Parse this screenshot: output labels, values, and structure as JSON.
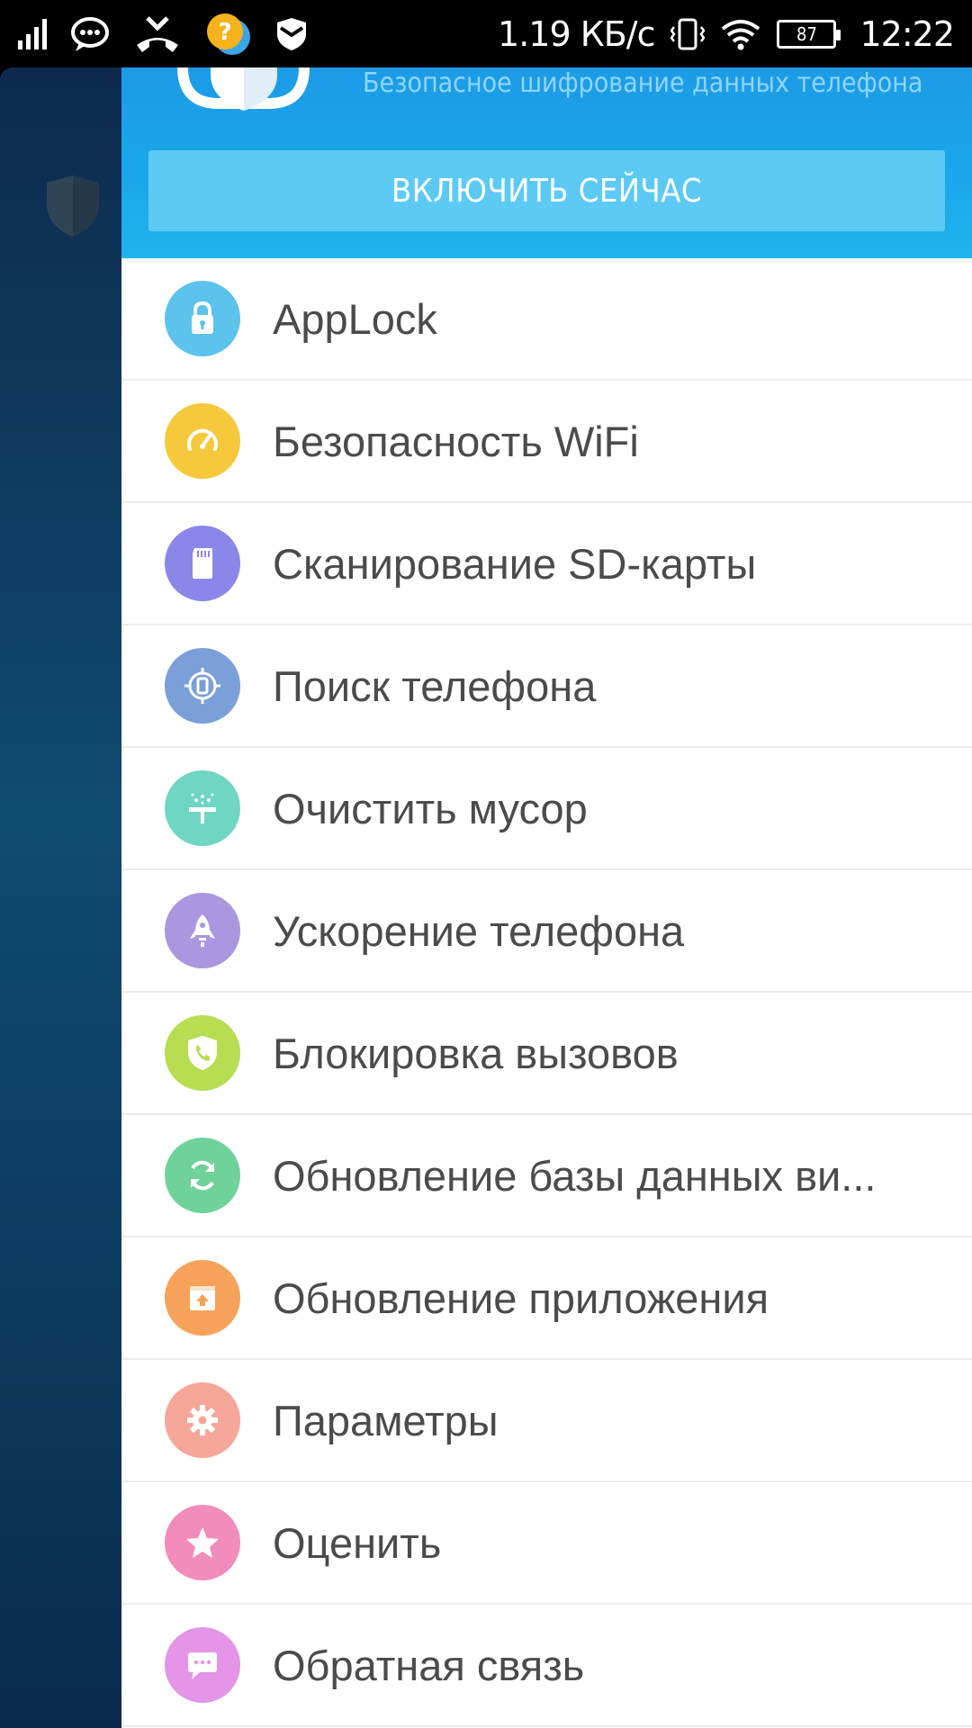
{
  "status_bar": {
    "network_speed": "1.19 КБ/с",
    "battery": "87",
    "time": "12:22"
  },
  "drawer": {
    "header": {
      "subtitle": "Безопасное шифрование данных телефона",
      "enable_button": "ВКЛЮЧИТЬ СЕЙЧАС"
    },
    "items": [
      {
        "label": "AppLock",
        "icon": "lock-icon",
        "color": "#5bc3ec"
      },
      {
        "label": "Безопасность WiFi",
        "icon": "speedometer-icon",
        "color": "#f6c93c"
      },
      {
        "label": "Сканирование SD-карты",
        "icon": "sd-card-icon",
        "color": "#8a87e8"
      },
      {
        "label": "Поиск телефона",
        "icon": "locate-phone-icon",
        "color": "#7a9fd9"
      },
      {
        "label": "Очистить мусор",
        "icon": "broom-icon",
        "color": "#6fd6c4"
      },
      {
        "label": "Ускорение телефона",
        "icon": "rocket-icon",
        "color": "#ab97df"
      },
      {
        "label": "Блокировка вызовов",
        "icon": "phone-shield-icon",
        "color": "#b7dd52"
      },
      {
        "label": "Обновление базы данных ви...",
        "icon": "refresh-icon",
        "color": "#6fd29a"
      },
      {
        "label": "Обновление приложения",
        "icon": "upload-box-icon",
        "color": "#f7a25a"
      },
      {
        "label": "Параметры",
        "icon": "gear-icon",
        "color": "#f7a69a"
      },
      {
        "label": "Оценить",
        "icon": "star-icon",
        "color": "#f28dbb"
      },
      {
        "label": "Обратная связь",
        "icon": "chat-bubble-icon",
        "color": "#e495e8"
      }
    ]
  }
}
